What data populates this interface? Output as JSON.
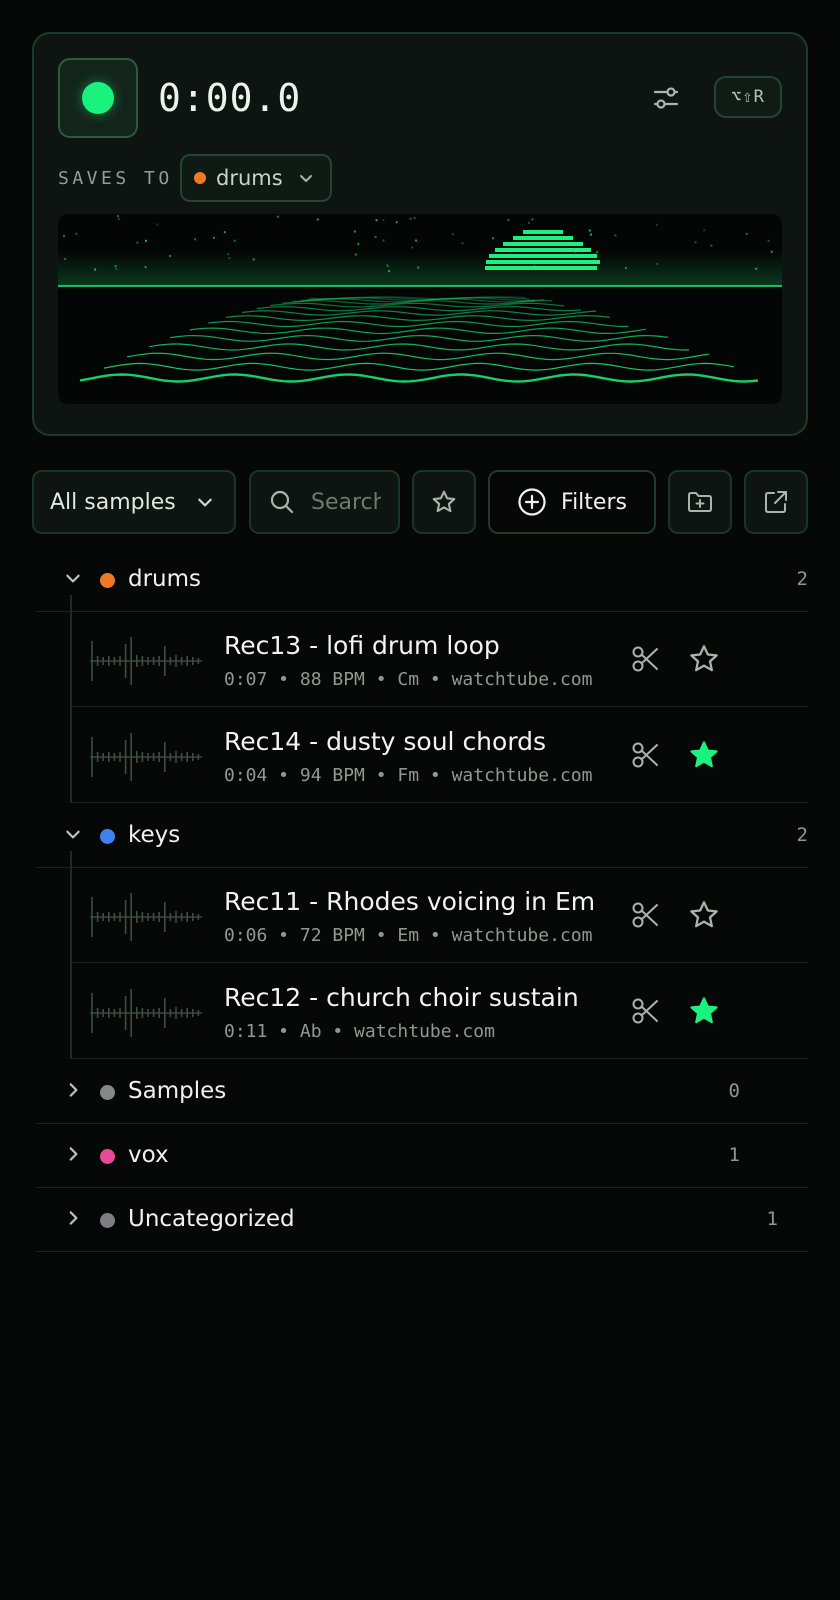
{
  "recorder": {
    "timer": "0:00.0",
    "shortcut": "⌥⇧R",
    "saves_to_label": "SAVES TO",
    "saves_to_value": "drums",
    "saves_to_color": "#f07a22",
    "accent": "#1bf27e"
  },
  "toolbar": {
    "scope_label": "All samples",
    "search_placeholder": "Search",
    "filters_label": "Filters"
  },
  "groups": [
    {
      "name": "drums",
      "color": "#f07a22",
      "count": "2",
      "expanded": true,
      "items": [
        {
          "title": "Rec13 - lofi drum loop",
          "meta": "0:07 • 88 BPM • Cm • watchtube.com",
          "favorite": false
        },
        {
          "title": "Rec14 - dusty soul chords",
          "meta": "0:04 • 94 BPM • Fm • watchtube.com",
          "favorite": true
        }
      ]
    },
    {
      "name": "keys",
      "color": "#3d82f0",
      "count": "2",
      "expanded": true,
      "items": [
        {
          "title": "Rec11 - Rhodes voicing in Em",
          "meta": "0:06 • 72 BPM • Em • watchtube.com",
          "favorite": false
        },
        {
          "title": "Rec12 - church choir sustain",
          "meta": "0:11 • Ab • watchtube.com",
          "favorite": true
        }
      ]
    },
    {
      "name": "Samples",
      "color": "#828a86",
      "count": "0",
      "expanded": false,
      "items": []
    },
    {
      "name": "vox",
      "color": "#e8489a",
      "count": "1",
      "expanded": false,
      "items": []
    },
    {
      "name": "Uncategorized",
      "color": "#7b7f84",
      "count": "1",
      "expanded": false,
      "items": []
    }
  ]
}
